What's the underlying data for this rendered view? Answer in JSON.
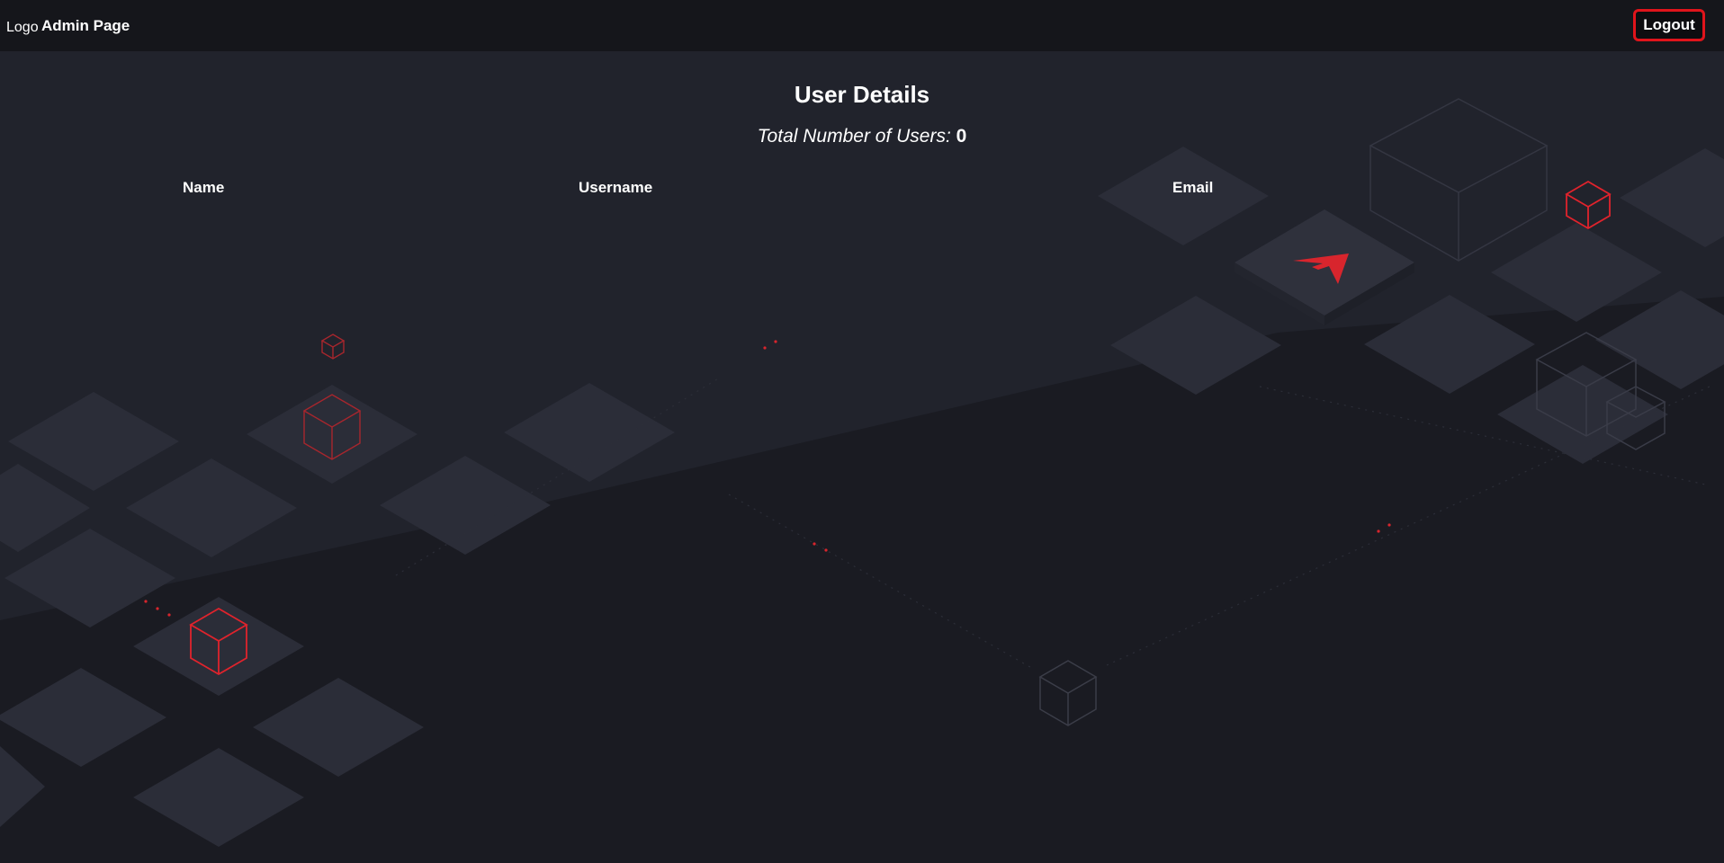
{
  "navbar": {
    "logo_text": "Logo",
    "title": "Admin Page",
    "logout_label": "Logout"
  },
  "main": {
    "heading": "User Details",
    "total_label": "Total Number of Users:",
    "total_value": "0",
    "table": {
      "columns": [
        "Name",
        "Username",
        "Email"
      ],
      "rows": []
    }
  },
  "colors": {
    "background": "#1a1b22",
    "navbar": "#15161b",
    "accent": "#e0141b",
    "text": "#ffffff"
  }
}
